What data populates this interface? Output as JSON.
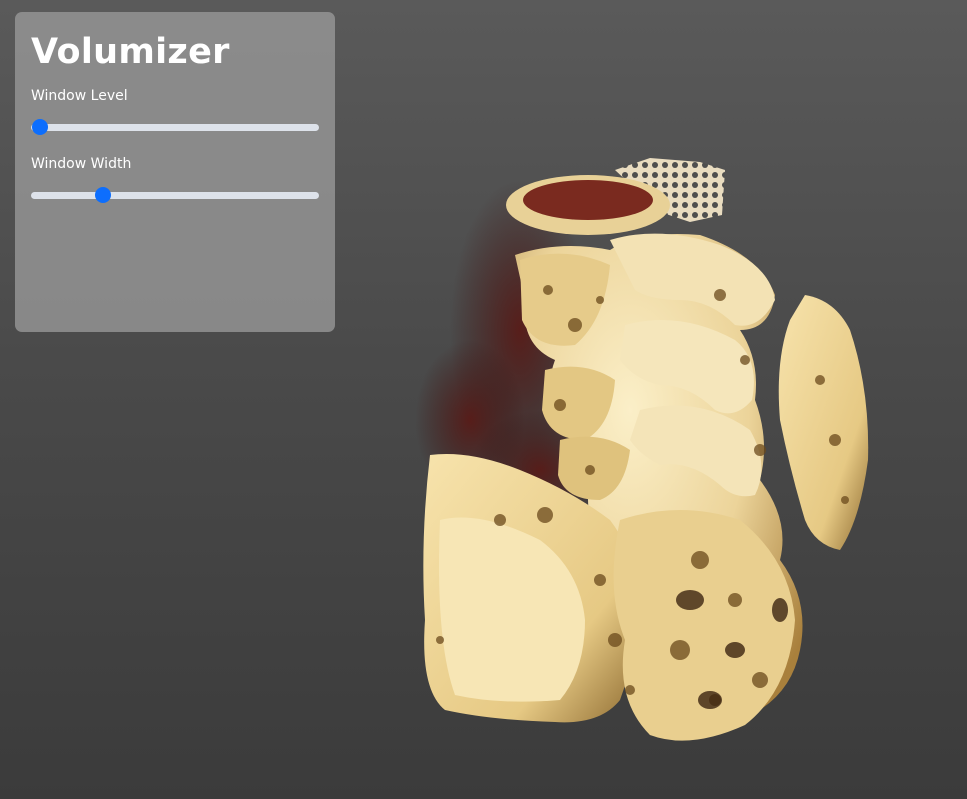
{
  "app": {
    "title": "Volumizer"
  },
  "controls": {
    "window_level": {
      "label": "Window Level",
      "value_fraction": 0.03
    },
    "window_width": {
      "label": "Window Width",
      "value_fraction": 0.25
    }
  },
  "colors": {
    "panel_bg": "#969696",
    "slider_track": "#dde2ea",
    "slider_thumb": "#0d6efd",
    "bone": "#f2dca4",
    "bone_shadow": "#b08a44",
    "tissue_red": "#6b1e18"
  },
  "viewport": {
    "content": "3d-volume-render-spine"
  }
}
